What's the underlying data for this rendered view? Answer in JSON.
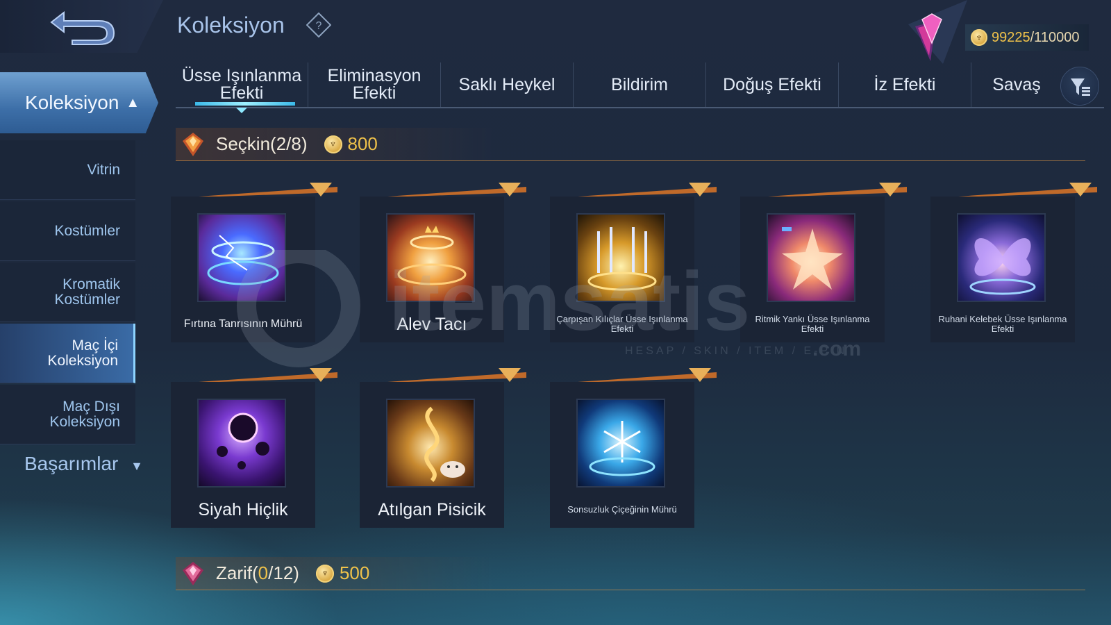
{
  "header": {
    "title": "Koleksiyon",
    "back_icon": "back-arrow-icon",
    "help_icon": "help-diamond-icon"
  },
  "currency": {
    "value": "99225",
    "max": "/110000",
    "icon": "collection-coin-icon"
  },
  "sidebar": {
    "main_label": "Koleksiyon",
    "items": [
      {
        "label": "Vitrin"
      },
      {
        "label": "Kostümler"
      },
      {
        "label": "Kromatik Kostümler"
      },
      {
        "label": "Maç İçi Koleksiyon"
      },
      {
        "label": "Maç Dışı Koleksiyon"
      }
    ],
    "active_index": 3,
    "achievements_label": "Başarımlar"
  },
  "tabs": [
    {
      "label": "Üsse Işınlanma Efekti",
      "active": true
    },
    {
      "label": "Eliminasyon Efekti",
      "active": false
    },
    {
      "label": "Saklı Heykel",
      "active": false
    },
    {
      "label": "Bildirim",
      "active": false
    },
    {
      "label": "Doğuş Efekti",
      "active": false
    },
    {
      "label": "İz Efekti",
      "active": false
    },
    {
      "label": "Savaş",
      "active": false
    }
  ],
  "sections": [
    {
      "label": "Seçkin(2/8)",
      "cost": "800",
      "items": [
        {
          "name": "Fırtına Tanrısının Mührü"
        },
        {
          "name": "Alev Tacı"
        },
        {
          "name": "Çarpışan Kılıçlar Üsse Işınlanma Efekti"
        },
        {
          "name": "Ritmik Yankı Üsse Işınlanma Efekti"
        },
        {
          "name": "Ruhani Kelebek Üsse Işınlanma Efekti"
        },
        {
          "name": "Siyah Hiçlik"
        },
        {
          "name": "Atılgan Pisicik"
        },
        {
          "name": "Sonsuzluk Çiçeğinin Mührü"
        }
      ]
    },
    {
      "label_prefix": "Zarif(",
      "label_count": "0",
      "label_suffix": "/12)",
      "cost": "500"
    }
  ],
  "watermark": {
    "brand": "itemsatis",
    "tagline": "HESAP / SKIN / ITEM / E-PIN",
    "suffix": ".com"
  },
  "colors": {
    "gold": "#f0c24a",
    "accent_blue": "#6fa0d0",
    "bg_dark": "#1d2a3e",
    "card_bg": "#1b2435"
  }
}
